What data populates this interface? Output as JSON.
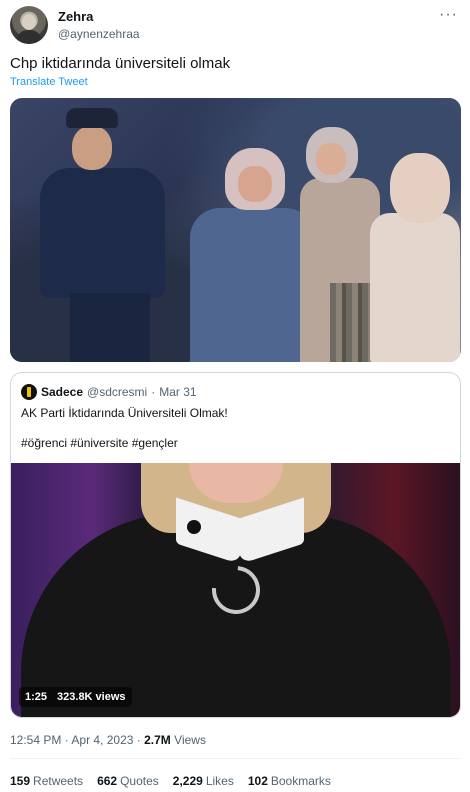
{
  "author": {
    "name": "Zehra",
    "handle": "@aynenzehraa",
    "avatar_icon": "avatar-icon"
  },
  "tweet": {
    "text": "Chp iktidarında üniversiteli olmak",
    "translate_label": "Translate Tweet",
    "more_icon": "more-icon"
  },
  "quoted": {
    "name": "Sadece",
    "handle": "@sdcresmi",
    "separator": "·",
    "date": "Mar 31",
    "text": "AK Parti İktidarında Üniversiteli Olmak!",
    "hashtags": "#öğrenci #üniversite #gençler",
    "video": {
      "duration": "1:25",
      "views": "323.8K views"
    }
  },
  "meta": {
    "time": "12:54 PM",
    "separator": "·",
    "date": "Apr 4, 2023",
    "separator2": "·",
    "views_count": "2.7M",
    "views_label": "Views"
  },
  "stats": [
    {
      "count": "159",
      "label": "Retweets"
    },
    {
      "count": "662",
      "label": "Quotes"
    },
    {
      "count": "2,229",
      "label": "Likes"
    },
    {
      "count": "102",
      "label": "Bookmarks"
    }
  ],
  "colors": {
    "link": "#1d9bf0",
    "muted": "#536471",
    "border": "#cfd9de"
  }
}
